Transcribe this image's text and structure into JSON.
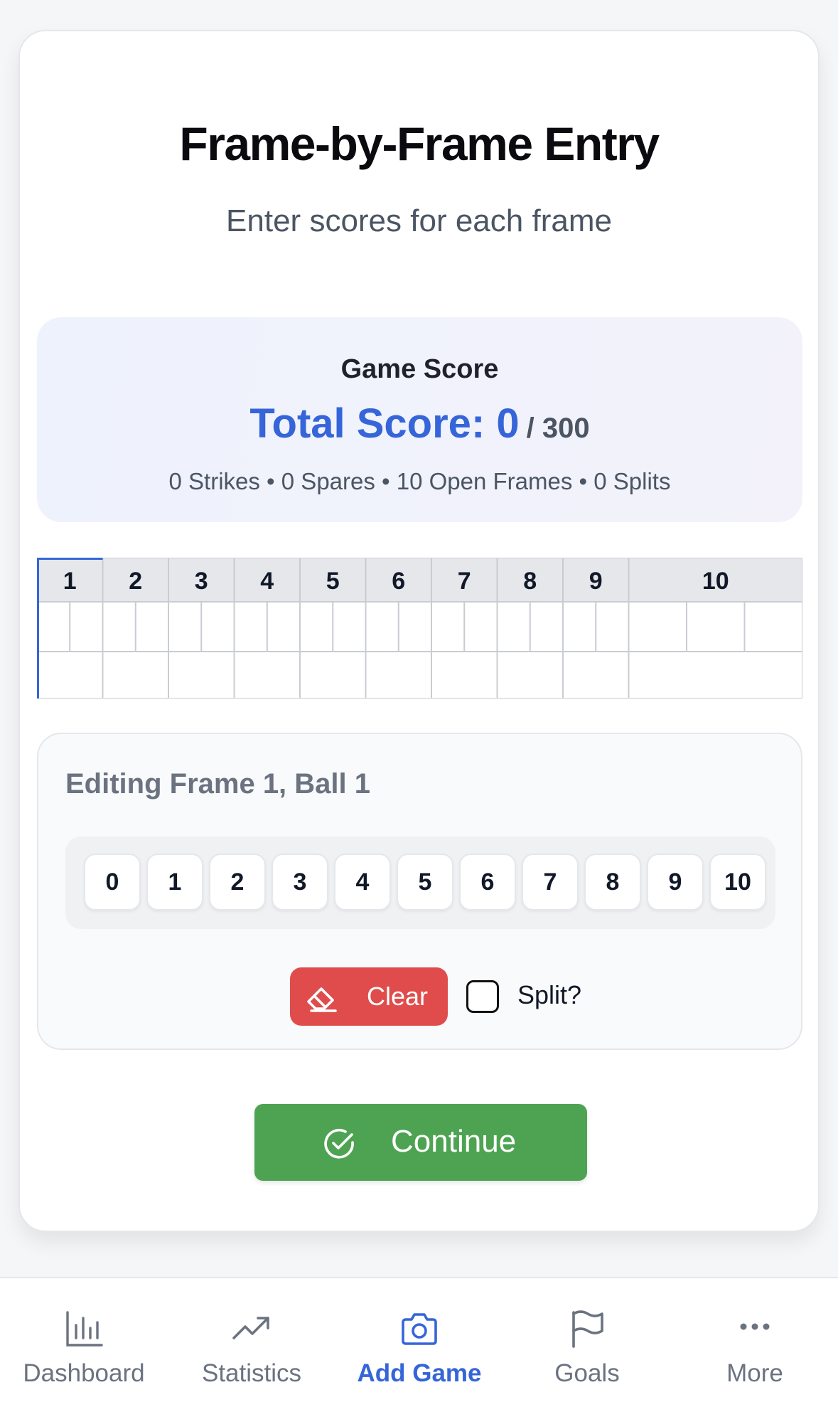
{
  "header": {
    "title": "Frame-by-Frame Entry",
    "subtitle": "Enter scores for each frame"
  },
  "score": {
    "label": "Game Score",
    "total_label": "Total Score: 0",
    "max_label": "/ 300",
    "stats": "0 Strikes • 0 Spares • 10 Open Frames • 0 Splits"
  },
  "scoresheet": {
    "frames": [
      "1",
      "2",
      "3",
      "4",
      "5",
      "6",
      "7",
      "8",
      "9",
      "10"
    ],
    "active_frame": 1
  },
  "editor": {
    "label": "Editing Frame 1, Ball 1",
    "pins": [
      "0",
      "1",
      "2",
      "3",
      "4",
      "5",
      "6",
      "7",
      "8",
      "9",
      "10"
    ],
    "clear_label": "Clear",
    "split_label": "Split?",
    "split_checked": false
  },
  "actions": {
    "continue_label": "Continue"
  },
  "tabs": [
    {
      "label": "Dashboard",
      "icon": "bar-chart-icon"
    },
    {
      "label": "Statistics",
      "icon": "trending-up-icon"
    },
    {
      "label": "Add Game",
      "icon": "camera-icon",
      "active": true
    },
    {
      "label": "Goals",
      "icon": "flag-icon"
    },
    {
      "label": "More",
      "icon": "more-dots-icon"
    }
  ],
  "colors": {
    "accent": "#3565d8",
    "clear": "#e04c4c",
    "continue": "#4ea352"
  }
}
